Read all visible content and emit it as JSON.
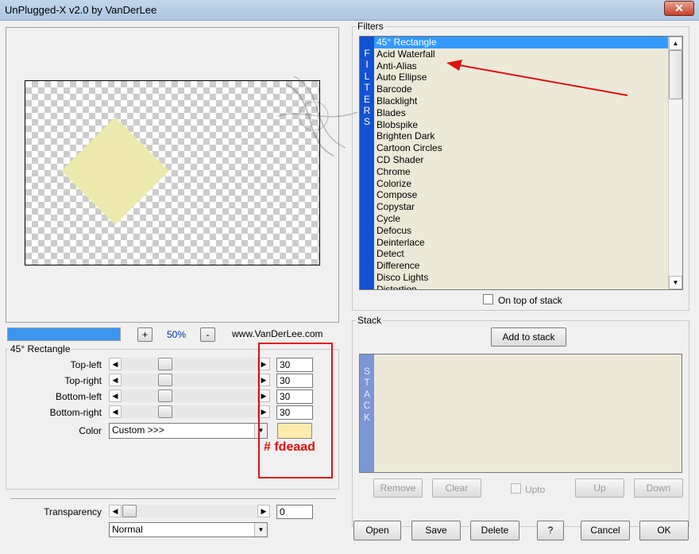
{
  "window": {
    "title": "UnPlugged-X v2.0 by VanDerLee",
    "close_glyph": "✕"
  },
  "preview": {
    "shape_color": "#eeeaaf"
  },
  "zoom": {
    "minus": "-",
    "plus": "+",
    "value": "50%",
    "website": "www.VanDerLee.com",
    "progress_fraction": 1.0
  },
  "params": {
    "group_label": "45° Rectangle",
    "rows": [
      {
        "label": "Top-left",
        "value": "30"
      },
      {
        "label": "Top-right",
        "value": "30"
      },
      {
        "label": "Bottom-left",
        "value": "30"
      },
      {
        "label": "Bottom-right",
        "value": "30"
      }
    ],
    "color_label": "Color",
    "color_value": "Custom >>>",
    "color_hex": "#fdeaad",
    "annotation": "# fdeaad"
  },
  "transparency": {
    "label": "Transparency",
    "value": "0",
    "blend_mode": "Normal"
  },
  "filters": {
    "group_label": "Filters",
    "strip_letters": [
      "F",
      "I",
      "L",
      "T",
      "E",
      "R",
      "S"
    ],
    "items": [
      "45° Rectangle",
      "Acid Waterfall",
      "Anti-Alias",
      "Auto Ellipse",
      "Barcode",
      "Blacklight",
      "Blades",
      "Blobspike",
      "Brighten Dark",
      "Cartoon Circles",
      "CD Shader",
      "Chrome",
      "Colorize",
      "Compose",
      "Copystar",
      "Cycle",
      "Defocus",
      "Deinterlace",
      "Detect",
      "Difference",
      "Disco Lights",
      "Distortion"
    ],
    "selected_index": 0,
    "on_top_label": "On top of stack"
  },
  "stack": {
    "group_label": "Stack",
    "add_button": "Add to stack",
    "strip_letters": [
      "S",
      "T",
      "A",
      "C",
      "K"
    ],
    "remove": "Remove",
    "clear": "Clear",
    "upto": "Upto",
    "up": "Up",
    "down": "Down"
  },
  "footer": {
    "open": "Open",
    "save": "Save",
    "delete": "Delete",
    "help": "?",
    "cancel": "Cancel",
    "ok": "OK"
  }
}
